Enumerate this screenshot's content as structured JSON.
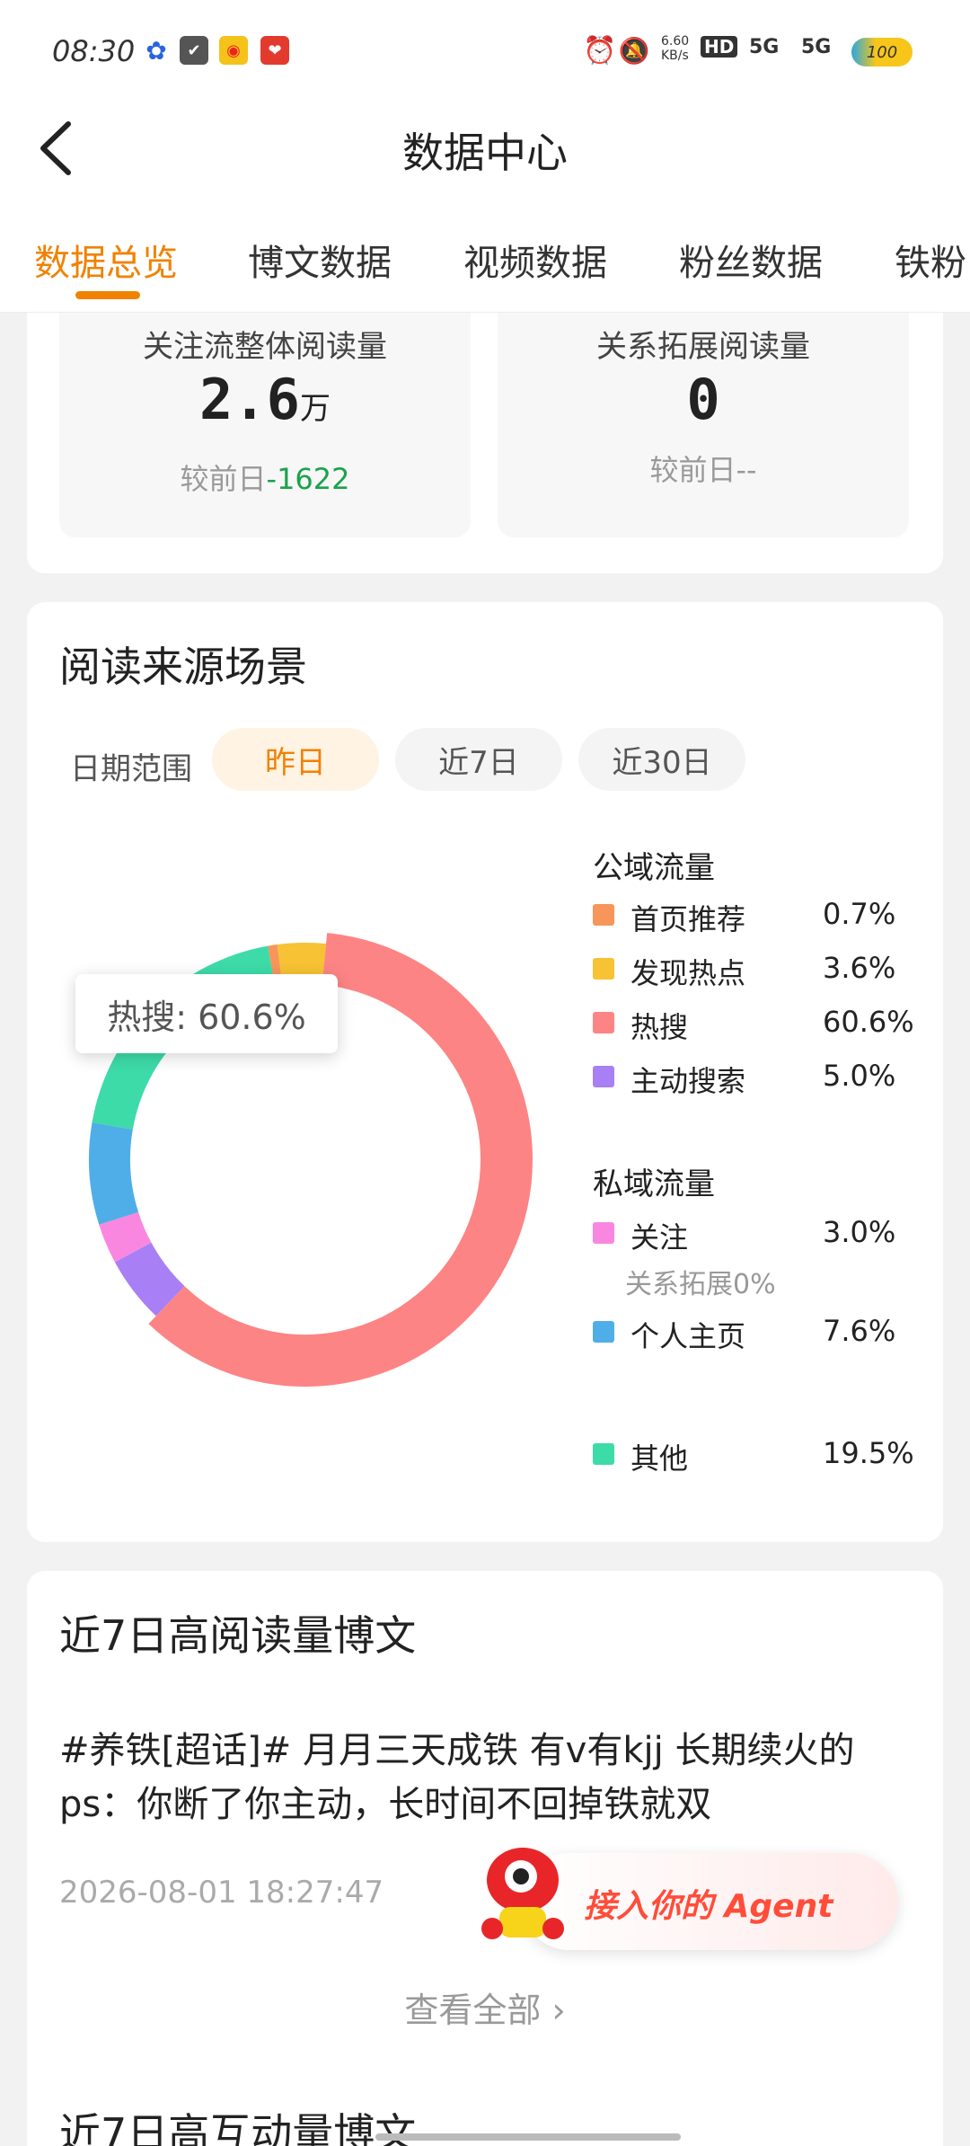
{
  "status_bar": {
    "time": "08:30",
    "net_speed": "6.60\nKB/s",
    "hd": "HD",
    "sig1": "5G",
    "sig2": "5G",
    "battery": "100"
  },
  "header": {
    "title": "数据中心"
  },
  "tabs": [
    {
      "label": "数据总览",
      "active": true
    },
    {
      "label": "博文数据"
    },
    {
      "label": "视频数据"
    },
    {
      "label": "粉丝数据"
    },
    {
      "label": "铁粉"
    }
  ],
  "stats": [
    {
      "label": "关注流整体阅读量",
      "value": "2.6",
      "unit": "万",
      "cmp_prefix": "较前日",
      "cmp_value": "-1622"
    },
    {
      "label": "关系拓展阅读量",
      "value": "0",
      "unit": "",
      "cmp_prefix": "较前日",
      "cmp_value": "--"
    }
  ],
  "read_source": {
    "title": "阅读来源场景",
    "date_label": "日期范围",
    "pills": [
      "昨日",
      "近7日",
      "近30日"
    ],
    "selected_pill": "昨日",
    "tooltip": "热搜: 60.6%",
    "public_heading": "公域流量",
    "private_heading": "私域流量",
    "legend_public": [
      {
        "name": "首页推荐",
        "pct": "0.7%",
        "color": "#f8955a"
      },
      {
        "name": "发现热点",
        "pct": "3.6%",
        "color": "#f7c234"
      },
      {
        "name": "热搜",
        "pct": "60.6%",
        "color": "#fd8484"
      },
      {
        "name": "主动搜索",
        "pct": "5.0%",
        "color": "#a97ff5"
      }
    ],
    "legend_private": [
      {
        "name": "关注",
        "pct": "3.0%",
        "color": "#f987e0"
      },
      {
        "name": "个人主页",
        "pct": "7.6%",
        "color": "#4faee8"
      }
    ],
    "relation_note": "关系拓展0%",
    "legend_other": {
      "name": "其他",
      "pct": "19.5%",
      "color": "#3ddba8"
    }
  },
  "chart_data": {
    "type": "pie",
    "categories": [
      "首页推荐",
      "发现热点",
      "热搜",
      "主动搜索",
      "关注",
      "个人主页",
      "其他"
    ],
    "values": [
      0.7,
      3.6,
      60.6,
      5.0,
      3.0,
      7.6,
      19.5
    ],
    "colors": [
      "#f8955a",
      "#f7c234",
      "#fd8484",
      "#a97ff5",
      "#f987e0",
      "#4faee8",
      "#3ddba8"
    ],
    "highlighted": "热搜"
  },
  "top_posts": {
    "title": "近7日高阅读量博文",
    "post_text": "#养铁[超话]# 月月三天成铁 有v有kjj 长期续火的 ps：你断了你主动，长时间不回掉铁就双",
    "post_time": "2026-08-01 18:27:47",
    "view_all": "查看全部"
  },
  "agent_float": {
    "label": "接入你的 Agent"
  },
  "next_section": {
    "title": "近7日高互动量博文"
  }
}
